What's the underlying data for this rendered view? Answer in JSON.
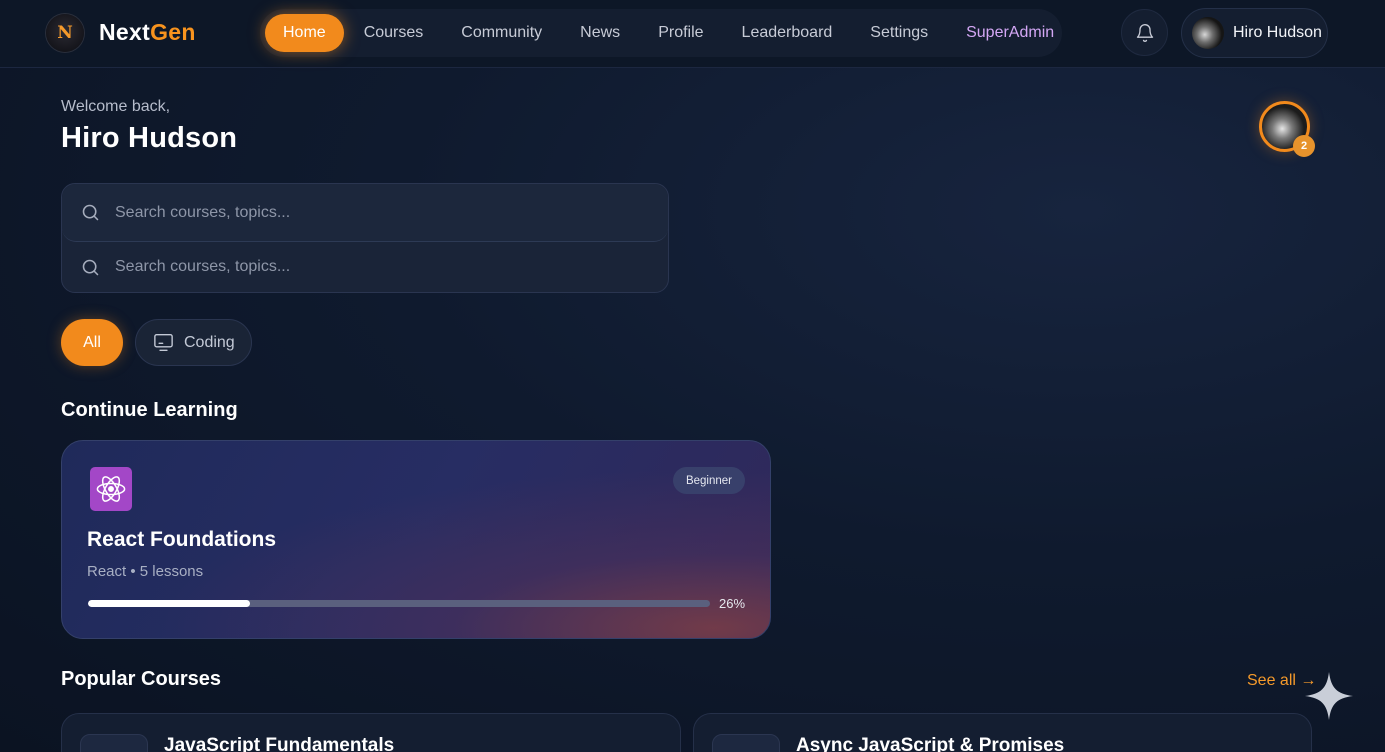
{
  "brand": {
    "part1": "Next",
    "part2": "Gen",
    "logo_letter": "N"
  },
  "nav": {
    "items": [
      {
        "label": "Home",
        "active": true
      },
      {
        "label": "Courses"
      },
      {
        "label": "Community"
      },
      {
        "label": "News"
      },
      {
        "label": "Profile"
      },
      {
        "label": "Leaderboard"
      },
      {
        "label": "Settings"
      },
      {
        "label": "SuperAdmin"
      }
    ]
  },
  "user": {
    "name": "Hiro Hudson",
    "level": "2"
  },
  "welcome": {
    "greeting": "Welcome back,",
    "name": "Hiro Hudson"
  },
  "search": {
    "placeholder": "Search courses, topics...",
    "placeholder_2": "Search courses, topics..."
  },
  "filters": {
    "all": "All",
    "coding": "Coding"
  },
  "continue_learning": {
    "title": "Continue Learning",
    "course": {
      "title": "React Foundations",
      "meta": "React • 5 lessons",
      "level": "Beginner",
      "progress": 0.26,
      "progress_label": "26%"
    }
  },
  "popular": {
    "title": "Popular Courses",
    "see_all": "See all →",
    "courses": [
      {
        "title": "JavaScript Fundamentals"
      },
      {
        "title": "Async JavaScript & Promises"
      }
    ]
  },
  "colors": {
    "accent": "#f28a1c",
    "admin": "#d4a7f5",
    "react_icon": "#a347c7"
  }
}
